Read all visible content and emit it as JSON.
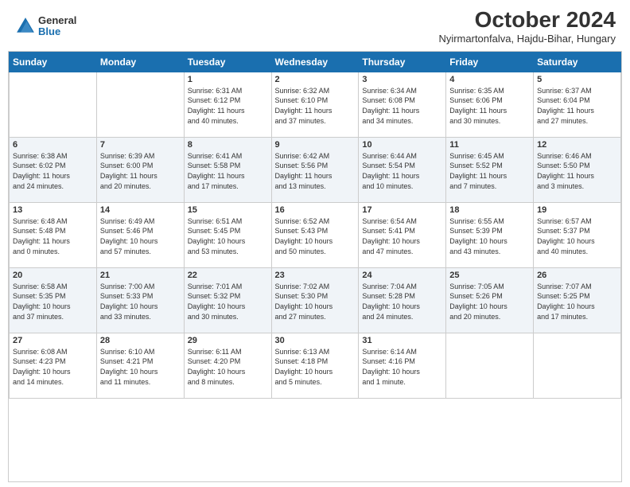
{
  "header": {
    "logo_general": "General",
    "logo_blue": "Blue",
    "title": "October 2024",
    "location": "Nyirmartonfalva, Hajdu-Bihar, Hungary"
  },
  "days_of_week": [
    "Sunday",
    "Monday",
    "Tuesday",
    "Wednesday",
    "Thursday",
    "Friday",
    "Saturday"
  ],
  "weeks": [
    [
      {
        "day": "",
        "info": ""
      },
      {
        "day": "",
        "info": ""
      },
      {
        "day": "1",
        "info": "Sunrise: 6:31 AM\nSunset: 6:12 PM\nDaylight: 11 hours\nand 40 minutes."
      },
      {
        "day": "2",
        "info": "Sunrise: 6:32 AM\nSunset: 6:10 PM\nDaylight: 11 hours\nand 37 minutes."
      },
      {
        "day": "3",
        "info": "Sunrise: 6:34 AM\nSunset: 6:08 PM\nDaylight: 11 hours\nand 34 minutes."
      },
      {
        "day": "4",
        "info": "Sunrise: 6:35 AM\nSunset: 6:06 PM\nDaylight: 11 hours\nand 30 minutes."
      },
      {
        "day": "5",
        "info": "Sunrise: 6:37 AM\nSunset: 6:04 PM\nDaylight: 11 hours\nand 27 minutes."
      }
    ],
    [
      {
        "day": "6",
        "info": "Sunrise: 6:38 AM\nSunset: 6:02 PM\nDaylight: 11 hours\nand 24 minutes."
      },
      {
        "day": "7",
        "info": "Sunrise: 6:39 AM\nSunset: 6:00 PM\nDaylight: 11 hours\nand 20 minutes."
      },
      {
        "day": "8",
        "info": "Sunrise: 6:41 AM\nSunset: 5:58 PM\nDaylight: 11 hours\nand 17 minutes."
      },
      {
        "day": "9",
        "info": "Sunrise: 6:42 AM\nSunset: 5:56 PM\nDaylight: 11 hours\nand 13 minutes."
      },
      {
        "day": "10",
        "info": "Sunrise: 6:44 AM\nSunset: 5:54 PM\nDaylight: 11 hours\nand 10 minutes."
      },
      {
        "day": "11",
        "info": "Sunrise: 6:45 AM\nSunset: 5:52 PM\nDaylight: 11 hours\nand 7 minutes."
      },
      {
        "day": "12",
        "info": "Sunrise: 6:46 AM\nSunset: 5:50 PM\nDaylight: 11 hours\nand 3 minutes."
      }
    ],
    [
      {
        "day": "13",
        "info": "Sunrise: 6:48 AM\nSunset: 5:48 PM\nDaylight: 11 hours\nand 0 minutes."
      },
      {
        "day": "14",
        "info": "Sunrise: 6:49 AM\nSunset: 5:46 PM\nDaylight: 10 hours\nand 57 minutes."
      },
      {
        "day": "15",
        "info": "Sunrise: 6:51 AM\nSunset: 5:45 PM\nDaylight: 10 hours\nand 53 minutes."
      },
      {
        "day": "16",
        "info": "Sunrise: 6:52 AM\nSunset: 5:43 PM\nDaylight: 10 hours\nand 50 minutes."
      },
      {
        "day": "17",
        "info": "Sunrise: 6:54 AM\nSunset: 5:41 PM\nDaylight: 10 hours\nand 47 minutes."
      },
      {
        "day": "18",
        "info": "Sunrise: 6:55 AM\nSunset: 5:39 PM\nDaylight: 10 hours\nand 43 minutes."
      },
      {
        "day": "19",
        "info": "Sunrise: 6:57 AM\nSunset: 5:37 PM\nDaylight: 10 hours\nand 40 minutes."
      }
    ],
    [
      {
        "day": "20",
        "info": "Sunrise: 6:58 AM\nSunset: 5:35 PM\nDaylight: 10 hours\nand 37 minutes."
      },
      {
        "day": "21",
        "info": "Sunrise: 7:00 AM\nSunset: 5:33 PM\nDaylight: 10 hours\nand 33 minutes."
      },
      {
        "day": "22",
        "info": "Sunrise: 7:01 AM\nSunset: 5:32 PM\nDaylight: 10 hours\nand 30 minutes."
      },
      {
        "day": "23",
        "info": "Sunrise: 7:02 AM\nSunset: 5:30 PM\nDaylight: 10 hours\nand 27 minutes."
      },
      {
        "day": "24",
        "info": "Sunrise: 7:04 AM\nSunset: 5:28 PM\nDaylight: 10 hours\nand 24 minutes."
      },
      {
        "day": "25",
        "info": "Sunrise: 7:05 AM\nSunset: 5:26 PM\nDaylight: 10 hours\nand 20 minutes."
      },
      {
        "day": "26",
        "info": "Sunrise: 7:07 AM\nSunset: 5:25 PM\nDaylight: 10 hours\nand 17 minutes."
      }
    ],
    [
      {
        "day": "27",
        "info": "Sunrise: 6:08 AM\nSunset: 4:23 PM\nDaylight: 10 hours\nand 14 minutes."
      },
      {
        "day": "28",
        "info": "Sunrise: 6:10 AM\nSunset: 4:21 PM\nDaylight: 10 hours\nand 11 minutes."
      },
      {
        "day": "29",
        "info": "Sunrise: 6:11 AM\nSunset: 4:20 PM\nDaylight: 10 hours\nand 8 minutes."
      },
      {
        "day": "30",
        "info": "Sunrise: 6:13 AM\nSunset: 4:18 PM\nDaylight: 10 hours\nand 5 minutes."
      },
      {
        "day": "31",
        "info": "Sunrise: 6:14 AM\nSunset: 4:16 PM\nDaylight: 10 hours\nand 1 minute."
      },
      {
        "day": "",
        "info": ""
      },
      {
        "day": "",
        "info": ""
      }
    ]
  ]
}
